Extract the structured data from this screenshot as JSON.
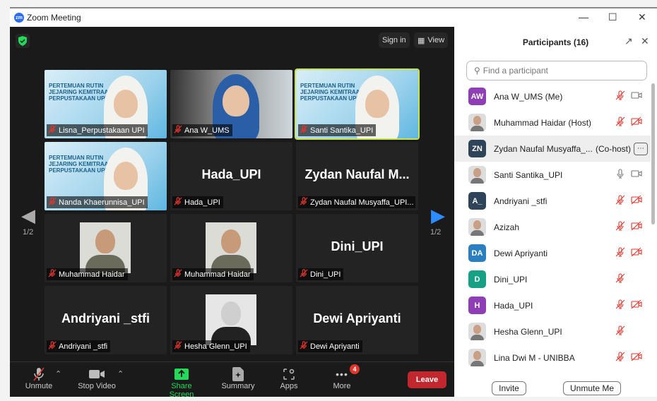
{
  "window": {
    "title": "Zoom Meeting",
    "logo": "zm"
  },
  "video": {
    "sign_in": "Sign in",
    "view": "View",
    "page_left": "1/2",
    "page_right": "1/2"
  },
  "tiles": [
    {
      "label": "Lisna_Perpustakaan UPI",
      "type": "banner"
    },
    {
      "label": "Ana W_UMS",
      "type": "video"
    },
    {
      "label": "Santi Santika_UPI",
      "type": "banner",
      "active": true
    },
    {
      "label": "Nanda Khaerunnisa_UPI",
      "type": "banner"
    },
    {
      "label": "Hada_UPI",
      "type": "name",
      "big": "Hada_UPI"
    },
    {
      "label": "Zydan Naufal Musyaffa_UPI...",
      "type": "name",
      "big": "Zydan Naufal M..."
    },
    {
      "label": "Muhammad Haidar",
      "type": "photo"
    },
    {
      "label": "Muhammad Haidar",
      "type": "photo"
    },
    {
      "label": "Dini_UPI",
      "type": "name",
      "big": "Dini_UPI"
    },
    {
      "label": "Andriyani _stfi",
      "type": "name",
      "big": "Andriyani _stfi"
    },
    {
      "label": "Hesha Glenn_UPI",
      "type": "photo-bw"
    },
    {
      "label": "Dewi Apriyanti",
      "type": "name",
      "big": "Dewi Apriyanti"
    }
  ],
  "banner_text": "PERTEMUAN RUTIN\nJEJARING KEMITRAAN\nPERPUSTAKAAN UPI",
  "toolbar": {
    "unmute": "Unmute",
    "stop_video": "Stop Video",
    "share_screen": "Share Screen",
    "summary": "Summary",
    "apps": "Apps",
    "more": "More",
    "more_badge": "4",
    "leave": "Leave"
  },
  "participants": {
    "title": "Participants (16)",
    "search_placeholder": "Find a participant",
    "items": [
      {
        "initials": "AW",
        "color": "#8e3fb5",
        "name": "Ana W_UMS (Me)",
        "mic": "muted",
        "cam": "on"
      },
      {
        "photo": true,
        "name": "Muhammad Haidar (Host)",
        "mic": "muted",
        "cam": "off"
      },
      {
        "initials": "ZN",
        "color": "#2f4459",
        "name": "Zydan Naufal Musyaffa_...",
        "role": "(Co-host)",
        "more": true
      },
      {
        "photo": true,
        "name": "Santi Santika_UPI",
        "mic": "on",
        "cam": "on"
      },
      {
        "initials": "A_",
        "color": "#2f4459",
        "name": "Andriyani _stfi",
        "mic": "muted",
        "cam": "off"
      },
      {
        "photo": true,
        "name": "Azizah",
        "mic": "muted",
        "cam": "off"
      },
      {
        "initials": "DA",
        "color": "#2b7fc1",
        "name": "Dewi Apriyanti",
        "mic": "muted",
        "cam": "off"
      },
      {
        "initials": "D",
        "color": "#17a184",
        "name": "Dini_UPI",
        "mic": "muted"
      },
      {
        "initials": "H",
        "color": "#8e3fb5",
        "name": "Hada_UPI",
        "mic": "muted",
        "cam": "off"
      },
      {
        "photo": true,
        "name": "Hesha Glenn_UPI",
        "mic": "muted"
      },
      {
        "photo": true,
        "name": "Lina Dwi M - UNIBBA",
        "mic": "muted",
        "cam": "off"
      }
    ],
    "invite": "Invite",
    "unmute_me": "Unmute Me"
  },
  "colors": {
    "muted": "#e0352b",
    "share": "#23d959",
    "active_border": "#c7e34a",
    "leave": "#c1272d"
  }
}
